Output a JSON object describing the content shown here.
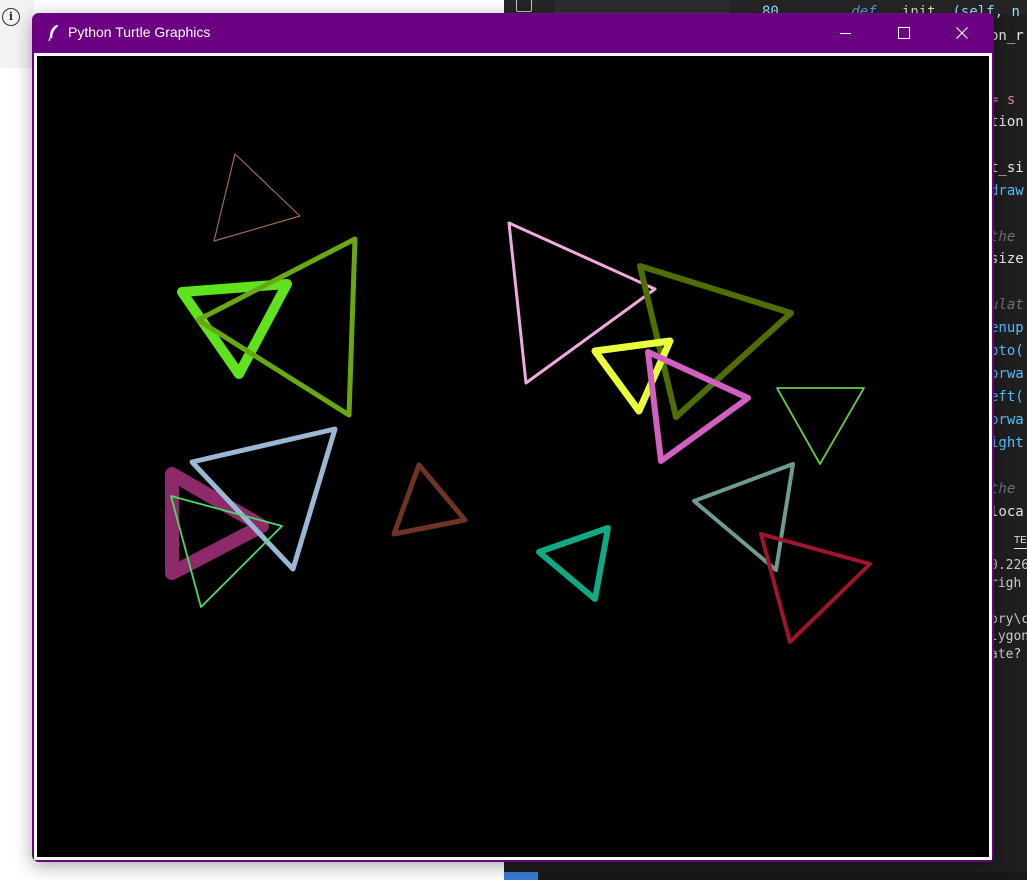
{
  "window": {
    "title": "Python Turtle Graphics",
    "accent_color": "#6b0082",
    "controls": [
      "minimize",
      "maximize",
      "close"
    ]
  },
  "canvas": {
    "background": "#000000",
    "shape": "triangle",
    "triangles": [
      {
        "color": "#a06c4a",
        "stroke": "thin"
      },
      {
        "color": "#5fe31f",
        "stroke": "thick"
      },
      {
        "color": "#6aa810",
        "stroke": "medium"
      },
      {
        "color": "#f2a8e0",
        "stroke": "medium"
      },
      {
        "color": "#4e6e00",
        "stroke": "thick"
      },
      {
        "color": "#e8ff3a",
        "stroke": "thick"
      },
      {
        "color": "#d160c0",
        "stroke": "thick"
      },
      {
        "color": "#66cc44",
        "stroke": "thin"
      },
      {
        "color": "#8e2a6a",
        "stroke": "very thick"
      },
      {
        "color": "#9ab7d4",
        "stroke": "medium"
      },
      {
        "color": "#44dd66",
        "stroke": "thin"
      },
      {
        "color": "#6e3323",
        "stroke": "thick"
      },
      {
        "color": "#11a884",
        "stroke": "thick"
      },
      {
        "color": "#6e9a94",
        "stroke": "medium"
      },
      {
        "color": "#a0142c",
        "stroke": "medium"
      }
    ]
  },
  "background": {
    "editor_partial_lines": [
      {
        "text": "= s",
        "color": "#e47eb7"
      },
      {
        "text": "tion",
        "color": "#e6e6e6"
      },
      {
        "text": "t_si",
        "color": "#e6e6e6"
      },
      {
        "text": "draw",
        "color": "#4fc1ff"
      },
      {
        "text": "the",
        "color": "#6a737d"
      },
      {
        "text": "size",
        "color": "#e6e6e6"
      },
      {
        "text": "ulat",
        "color": "#6a737d"
      },
      {
        "text": "enup",
        "color": "#4fc1ff"
      },
      {
        "text": "oto(",
        "color": "#4fc1ff"
      },
      {
        "text": "orwa",
        "color": "#4fc1ff"
      },
      {
        "text": "eft(",
        "color": "#4fc1ff"
      },
      {
        "text": "orwa",
        "color": "#4fc1ff"
      },
      {
        "text": "ight",
        "color": "#4fc1ff"
      },
      {
        "text": "the",
        "color": "#6a737d"
      },
      {
        "text": "loca",
        "color": "#e6e6e6"
      }
    ],
    "editor_header": {
      "line_number": "80",
      "keyword": "def",
      "fn": "__init__",
      "params": "(self, n",
      "second_line": "on_r"
    },
    "terminal_tab": "TE",
    "terminal_lines": [
      "0.226",
      " righ",
      "ory\\c",
      "lygon",
      "ate?"
    ]
  }
}
